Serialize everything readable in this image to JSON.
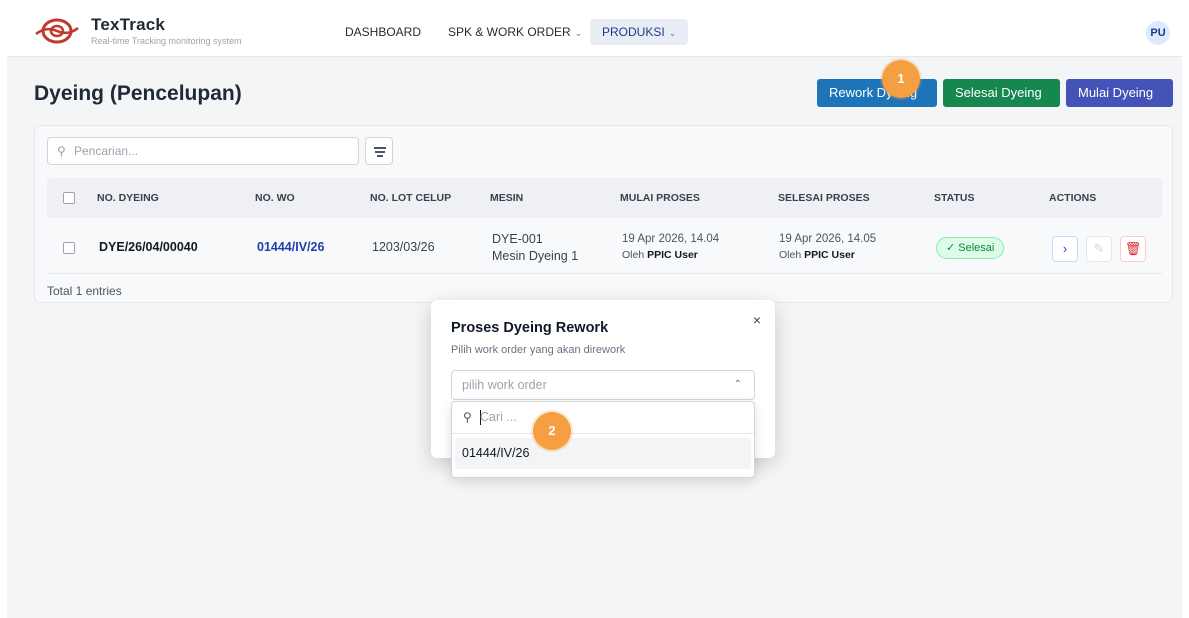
{
  "brand": {
    "name": "TexTrack",
    "tagline": "Real-time Tracking monitoring system"
  },
  "nav": {
    "items": [
      {
        "label": "DASHBOARD",
        "has_dropdown": false,
        "active": false
      },
      {
        "label": "SPK & WORK ORDER",
        "has_dropdown": true,
        "active": false
      },
      {
        "label": "PRODUKSI",
        "has_dropdown": true,
        "active": true
      }
    ],
    "user_initials": "PU"
  },
  "page": {
    "title": "Dyeing (Pencelupan)",
    "buttons": {
      "rework": "Rework Dyeing",
      "selesai": "Selesai Dyeing",
      "mulai": "Mulai Dyeing"
    }
  },
  "table": {
    "search_placeholder": "Pencarian...",
    "columns": [
      "NO. DYEING",
      "NO. WO",
      "NO. LOT CELUP",
      "MESIN",
      "MULAI PROSES",
      "SELESAI PROSES",
      "STATUS",
      "ACTIONS"
    ],
    "rows": [
      {
        "no_dyeing": "DYE/26/04/00040",
        "no_wo": "01444/IV/26",
        "no_lot_celup": "1203/03/26",
        "mesin_code": "DYE-001",
        "mesin_name": "Mesin Dyeing 1",
        "mulai_time": "19 Apr 2026, 14.04",
        "mulai_by_prefix": "Oleh",
        "mulai_by": "PPIC User",
        "selesai_time": "19 Apr 2026, 14.05",
        "selesai_by_prefix": "Oleh",
        "selesai_by": "PPIC User",
        "status": "Selesai"
      }
    ],
    "total_text": "Total 1 entries"
  },
  "modal": {
    "title": "Proses Dyeing Rework",
    "subtitle": "Pilih work order yang akan dirework",
    "select_placeholder": "pilih work order",
    "search_placeholder": "Cari ...",
    "options": [
      "01444/IV/26"
    ]
  },
  "markers": [
    "1",
    "2"
  ],
  "colors": {
    "rework": "#1d74b8",
    "selesai": "#16874e",
    "mulai": "#4553b8",
    "marker": "#f59e42",
    "link": "#1e40af",
    "status_ok": "#15803d"
  }
}
